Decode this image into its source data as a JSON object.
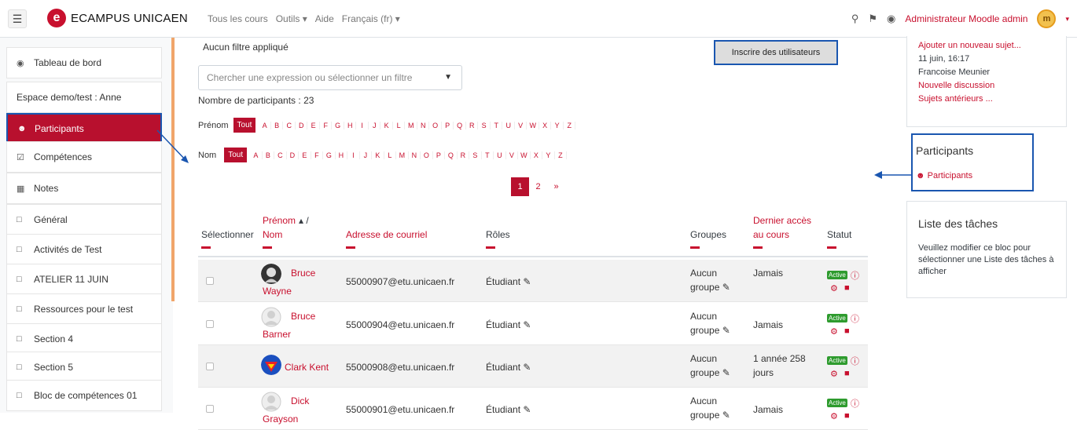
{
  "topbar": {
    "brand": "ECAMPUS UNICAEN",
    "nav": [
      "Tous les cours",
      "Outils ▾",
      "Aide",
      "Français (fr) ▾"
    ],
    "user": "Administrateur Moodle admin",
    "avatar_initials": "m"
  },
  "drawer": {
    "items": [
      {
        "icon": "dashboard-icon",
        "label": "Tableau de bord"
      },
      {
        "icon": "",
        "label": "Espace demo/test : Anne"
      },
      {
        "icon": "users-icon",
        "label": "Participants"
      },
      {
        "icon": "checkbox-icon",
        "label": "Compétences"
      },
      {
        "icon": "table-icon",
        "label": "Notes"
      },
      {
        "icon": "folder-icon",
        "label": "Général"
      },
      {
        "icon": "folder-icon",
        "label": "Activités de Test"
      },
      {
        "icon": "folder-icon",
        "label": "ATELIER 11 JUIN"
      },
      {
        "icon": "folder-icon",
        "label": "Ressources pour le test"
      },
      {
        "icon": "folder-icon",
        "label": "Section 4"
      },
      {
        "icon": "folder-icon",
        "label": "Section 5"
      },
      {
        "icon": "folder-icon",
        "label": "Bloc de compétences 01"
      }
    ]
  },
  "main": {
    "filter_status": "Aucun filtre appliqué",
    "enroll_button": "Inscrire des utilisateurs",
    "search_placeholder": "Chercher une expression ou sélectionner un filtre",
    "count": "Nombre de participants : 23",
    "firstname_label": "Prénom",
    "lastname_label": "Nom",
    "all_label": "Tout",
    "letters": [
      "A",
      "B",
      "C",
      "D",
      "E",
      "F",
      "G",
      "H",
      "I",
      "J",
      "K",
      "L",
      "M",
      "N",
      "O",
      "P",
      "Q",
      "R",
      "S",
      "T",
      "U",
      "V",
      "W",
      "X",
      "Y",
      "Z"
    ],
    "pages": [
      "1",
      "2",
      "»"
    ],
    "columns": {
      "select": "Sélectionner",
      "firstname": "Prénom",
      "sort_glyph": "▴ /",
      "lastname": "Nom",
      "email": "Adresse de courriel",
      "roles": "Rôles",
      "groups": "Groupes",
      "last_access_1": "Dernier accès",
      "last_access_2": "au cours",
      "status": "Statut"
    },
    "rows": [
      {
        "name1": "Bruce",
        "name2": "Wayne",
        "email": "55000907@etu.unicaen.fr",
        "role": "Étudiant",
        "group1": "Aucun",
        "group2": "groupe",
        "access1": "Jamais",
        "access2": "",
        "status": "Active"
      },
      {
        "name1": "Bruce",
        "name2": "Barner",
        "email": "55000904@etu.unicaen.fr",
        "role": "Étudiant",
        "group1": "Aucun",
        "group2": "groupe",
        "access1": "Jamais",
        "access2": "",
        "status": "Active"
      },
      {
        "name1": "Clark Kent",
        "name2": "",
        "email": "55000908@etu.unicaen.fr",
        "role": "Étudiant",
        "group1": "Aucun",
        "group2": "groupe",
        "access1": "1 année 258",
        "access2": "jours",
        "status": "Active"
      },
      {
        "name1": "Dick",
        "name2": "Grayson",
        "email": "55000901@etu.unicaen.fr",
        "role": "Étudiant",
        "group1": "Aucun",
        "group2": "groupe",
        "access1": "Jamais",
        "access2": "",
        "status": "Active"
      }
    ]
  },
  "blocks": {
    "news": {
      "link": "Ajouter un nouveau sujet...",
      "date": "11 juin, 16:17",
      "author": "Francoise Meunier",
      "discussion": "Nouvelle discussion",
      "older": "Sujets antérieurs ..."
    },
    "participants": {
      "title": "Participants",
      "link": "Participants"
    },
    "tasks": {
      "title": "Liste des tâches",
      "text": "Veuillez modifier ce bloc pour sélectionner une Liste des tâches à afficher"
    }
  },
  "colors": {
    "accent": "#c8102e",
    "highlight": "#1a56b0",
    "active": "#2e9b2e"
  }
}
